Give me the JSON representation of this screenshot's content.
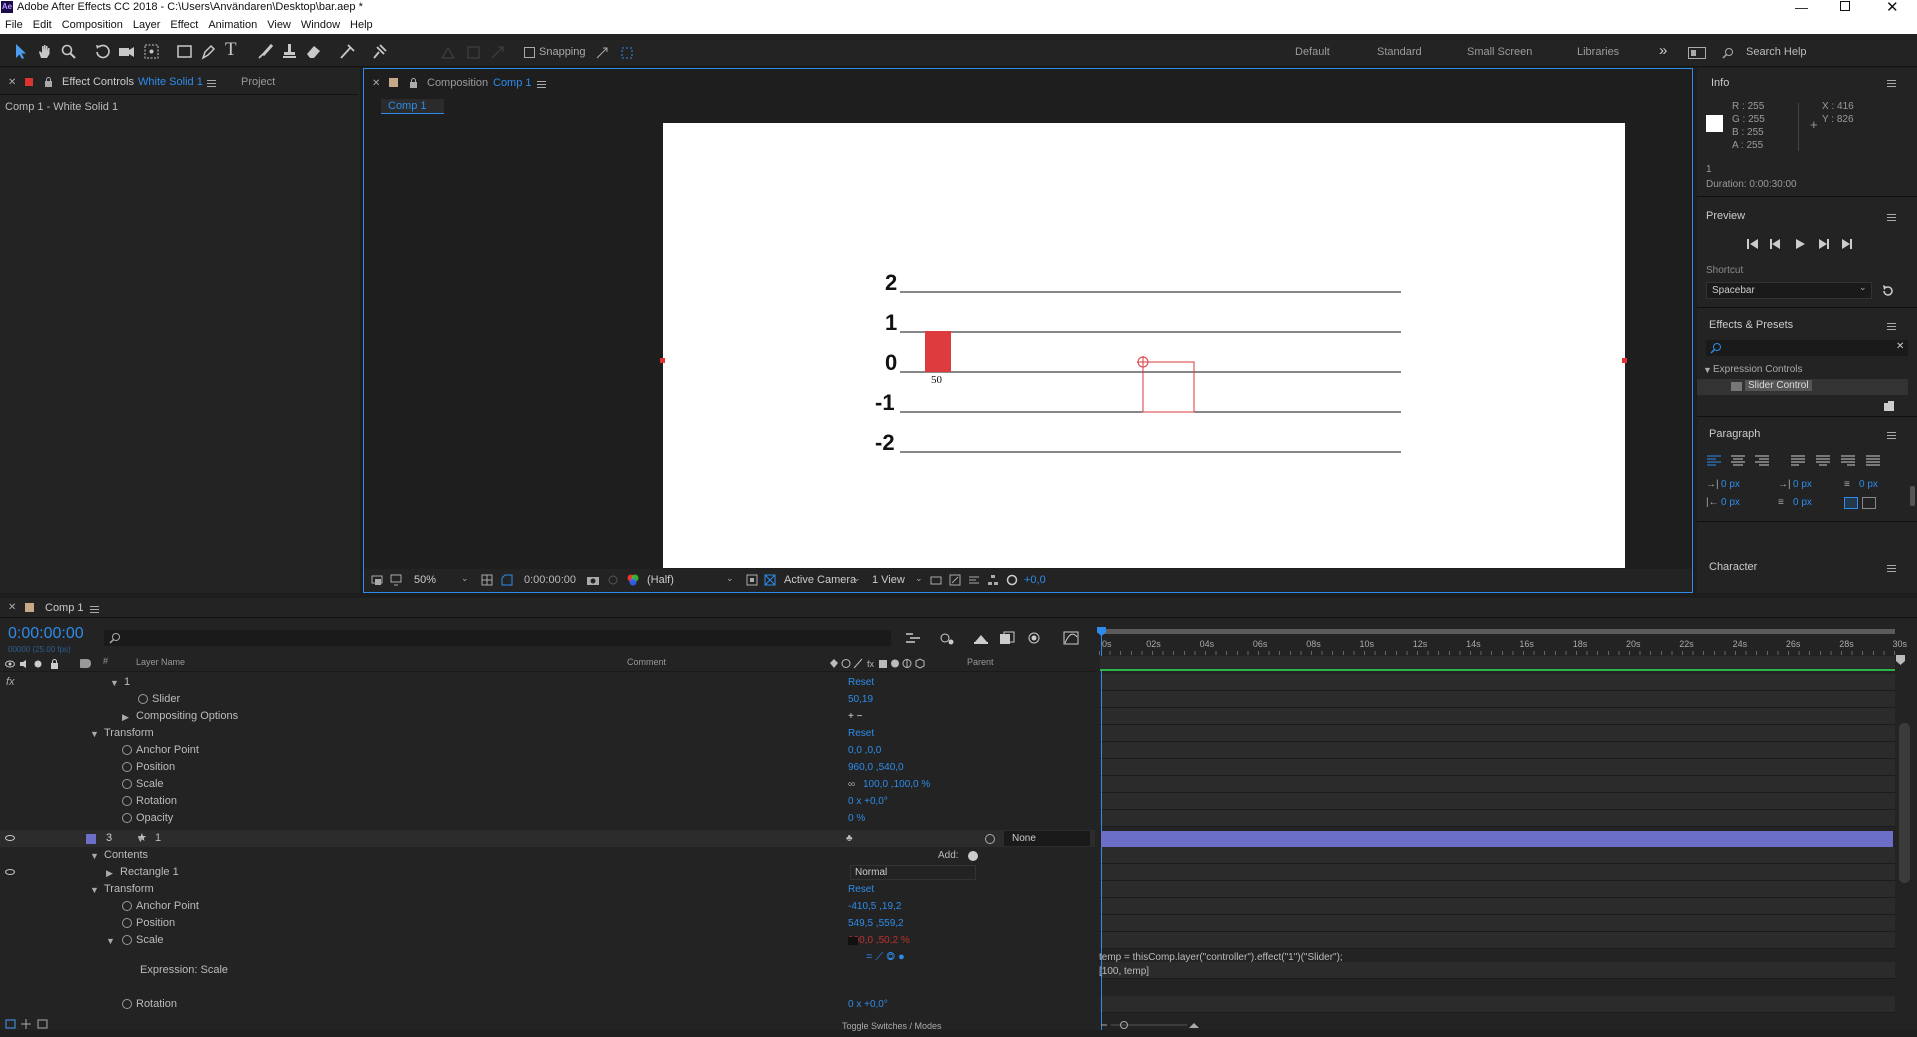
{
  "window": {
    "title": "Adobe After Effects CC 2018 - C:\\Users\\Användaren\\Desktop\\bar.aep *",
    "app_badge": "Ae"
  },
  "menu": [
    "File",
    "Edit",
    "Composition",
    "Layer",
    "Effect",
    "Animation",
    "View",
    "Window",
    "Help"
  ],
  "toolbar": {
    "snapping_label": "Snapping",
    "workspaces": [
      "Default",
      "Standard",
      "Small Screen",
      "Libraries"
    ],
    "overflow": "»",
    "search_help": "Search Help"
  },
  "effect_controls": {
    "tab_label": "Effect Controls",
    "tab_target": "White Solid 1",
    "project_tab": "Project",
    "breadcrumb": "Comp 1 - White Solid 1"
  },
  "composition": {
    "tab_label": "Composition",
    "tab_target": "Comp 1",
    "subtab": "Comp 1",
    "chart": {
      "tick_labels": [
        "2",
        "1",
        "0",
        "-1",
        "-2"
      ],
      "bar_label": "50"
    },
    "footer": {
      "zoom": "50%",
      "timecode": "0:00:00:00",
      "resolution": "(Half)",
      "camera": "Active Camera",
      "view": "1 View",
      "exposure": "+0,0"
    }
  },
  "info": {
    "title": "Info",
    "rgba": [
      {
        "k": "R",
        "v": "255"
      },
      {
        "k": "G",
        "v": "255"
      },
      {
        "k": "B",
        "v": "255"
      },
      {
        "k": "A",
        "v": "255"
      }
    ],
    "x": "X : 416",
    "y": "Y : 826",
    "layer_index": "1",
    "duration": "Duration: 0:00:30:00"
  },
  "preview": {
    "title": "Preview",
    "shortcut_label": "Shortcut",
    "shortcut_value": "Spacebar"
  },
  "effects_presets": {
    "title": "Effects & Presets",
    "search_placeholder": "",
    "category": "Expression Controls",
    "item": "Slider Control"
  },
  "paragraph": {
    "title": "Paragraph",
    "fields": [
      "0 px",
      "0 px",
      "0 px",
      "0 px",
      "0 px"
    ]
  },
  "character": {
    "title": "Character"
  },
  "timeline": {
    "tab_label": "Comp 1",
    "timecode": "0:00:00:00",
    "frame_info": "00000 (25.00 fps)",
    "columns": {
      "layer_name": "Layer Name",
      "comment": "Comment",
      "parent": "Parent"
    },
    "ruler": [
      "0s",
      "02s",
      "04s",
      "06s",
      "08s",
      "10s",
      "12s",
      "14s",
      "16s",
      "18s",
      "20s",
      "22s",
      "24s",
      "26s",
      "28s",
      "30s"
    ],
    "rows": [
      {
        "name": "1",
        "value": "Reset"
      },
      {
        "name": "Slider",
        "value": "50,19"
      },
      {
        "name": "Compositing Options",
        "value": "+ −"
      },
      {
        "name": "Transform",
        "value": "Reset"
      },
      {
        "name": "Anchor Point",
        "value": "0,0 ,0,0"
      },
      {
        "name": "Position",
        "value": "960,0 ,540,0"
      },
      {
        "name": "Scale",
        "value": "100,0 ,100,0 %"
      },
      {
        "name": "Rotation",
        "value": "0 x +0,0°"
      },
      {
        "name": "Opacity",
        "value": "0 %"
      },
      {
        "name": "1",
        "value": "None",
        "index": "3"
      },
      {
        "name": "Contents",
        "value": "Add:"
      },
      {
        "name": "Rectangle 1",
        "value": "Normal"
      },
      {
        "name": "Transform",
        "value": "Reset"
      },
      {
        "name": "Anchor Point",
        "value": "-410,5 ,19,2"
      },
      {
        "name": "Position",
        "value": "549,5 ,559,2"
      },
      {
        "name": "Scale",
        "value": "100,0 ,50,2 %"
      },
      {
        "name": "Expression: Scale",
        "value": ""
      },
      {
        "name": "Rotation",
        "value": "0 x +0,0°"
      }
    ],
    "expression": [
      "temp = thisComp.layer(\"controller\").effect(\"1\")(\"Slider\");",
      "[100, temp]"
    ],
    "toggle_label": "Toggle Switches / Modes"
  },
  "colors": {
    "accent": "#2d8ceb",
    "bar": "#dd3b3e",
    "label": "#6b6fc7"
  }
}
